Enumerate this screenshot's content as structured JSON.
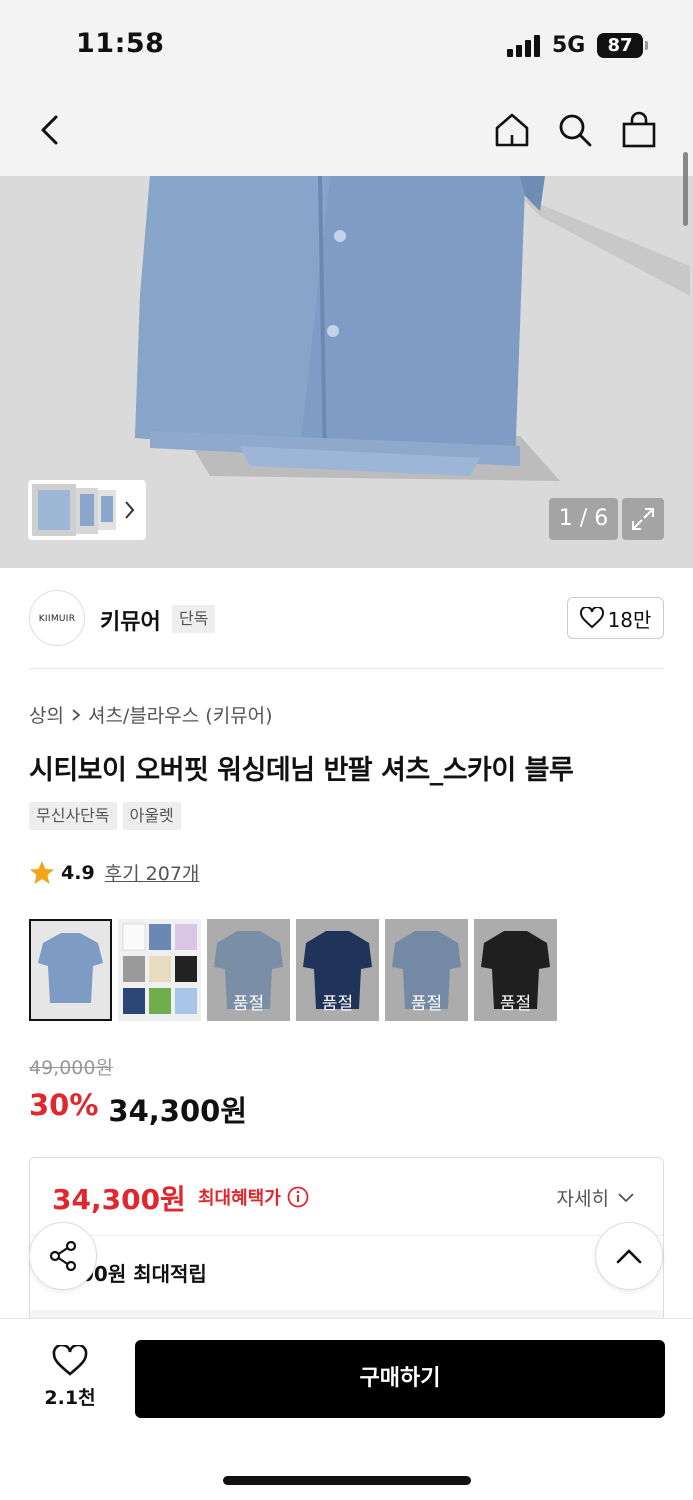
{
  "status": {
    "time": "11:58",
    "network": "5G",
    "battery": "87"
  },
  "nav": {
    "back": "back-icon",
    "home": "home-icon",
    "search": "search-icon",
    "cart": "shopping-bag-icon"
  },
  "gallery": {
    "counter": "1 / 6"
  },
  "brand": {
    "logo_text": "KIIMUIR",
    "name": "키뮤어",
    "tag": "단독",
    "likes": "18만"
  },
  "breadcrumb": {
    "level1": "상의",
    "level2": "셔츠/블라우스 (키뮤어)"
  },
  "product": {
    "title": "시티보이 오버핏 워싱데님 반팔 셔츠_스카이 블루",
    "tags": [
      "무신사단독",
      "아울렛"
    ],
    "rating": "4.9",
    "reviews": "후기 207개"
  },
  "variants": [
    {
      "sold_label": ""
    },
    {
      "sold_label": ""
    },
    {
      "sold_label": "품절"
    },
    {
      "sold_label": "품절"
    },
    {
      "sold_label": "품절"
    },
    {
      "sold_label": "품절"
    }
  ],
  "price": {
    "original": "49,000원",
    "discount": "30%",
    "sale": "34,300원"
  },
  "benefit": {
    "price": "34,300원",
    "label": "최대혜택가",
    "detail": "자세히",
    "points": "00원 최대적립"
  },
  "bottom": {
    "wish_count": "2.1천",
    "buy_label": "구매하기"
  },
  "colors": {
    "accent": "#e1262d",
    "buy_bg": "#000000"
  }
}
